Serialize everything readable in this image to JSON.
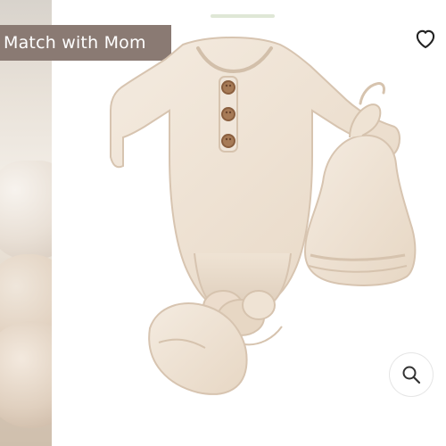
{
  "badge": {
    "label": "Match with Mom"
  },
  "icons": {
    "favorite": "heart-icon",
    "zoom": "search-icon"
  },
  "colors": {
    "badge_bg": "#8a7a73",
    "product": "#efe3d3"
  }
}
